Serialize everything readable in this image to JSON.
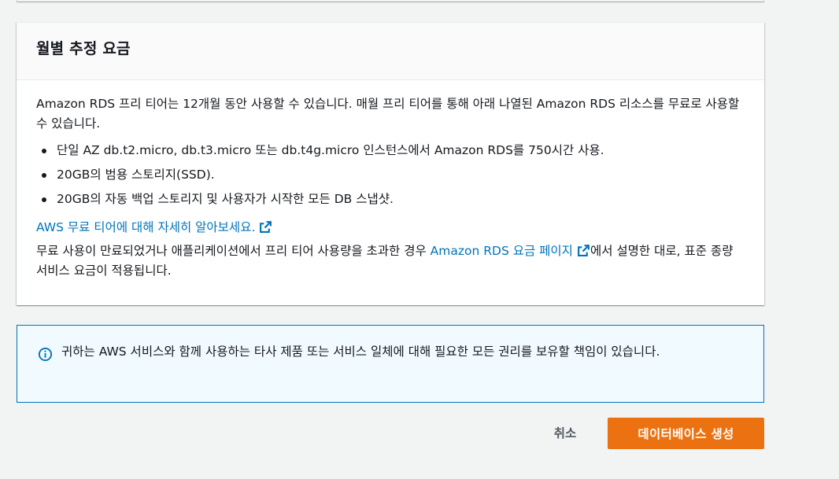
{
  "colors": {
    "background": "#f2f3f3",
    "card": "#ffffff",
    "link": "#0073bb",
    "primary_button": "#ec7211",
    "info_background": "#f1faff",
    "info_border": "#0073bb"
  },
  "cost_section": {
    "title": "월별 추정 요금",
    "intro": "Amazon RDS 프리 티어는 12개월 동안 사용할 수 있습니다. 매월 프리 티어를 통해 아래 나열된 Amazon RDS 리소스를 무료로 사용할 수 있습니다.",
    "bullets": [
      "단일 AZ db.t2.micro, db.t3.micro 또는 db.t4g.micro 인스턴스에서 Amazon RDS를 750시간 사용.",
      "20GB의 범용 스토리지(SSD).",
      "20GB의 자동 백업 스토리지 및 사용자가 시작한 모든 DB 스냅샷."
    ],
    "learn_more_link": "AWS 무료 티어에 대해 자세히 알아보세요.",
    "pricing_text_before": "무료 사용이 만료되었거나 애플리케이션에서 프리 티어 사용량을 초과한 경우 ",
    "pricing_link": "Amazon RDS 요금 페이지",
    "pricing_text_after": "에서 설명한 대로, 표준 종량 서비스 요금이 적용됩니다.",
    "external_icon": "external-link-icon"
  },
  "info_alert": {
    "icon": "info-icon",
    "text": "귀하는 AWS 서비스와 함께 사용하는 타사 제품 또는 서비스 일체에 대해 필요한 모든 권리를 보유할 책임이 있습니다."
  },
  "actions": {
    "cancel_label": "취소",
    "create_label": "데이터베이스 생성"
  }
}
